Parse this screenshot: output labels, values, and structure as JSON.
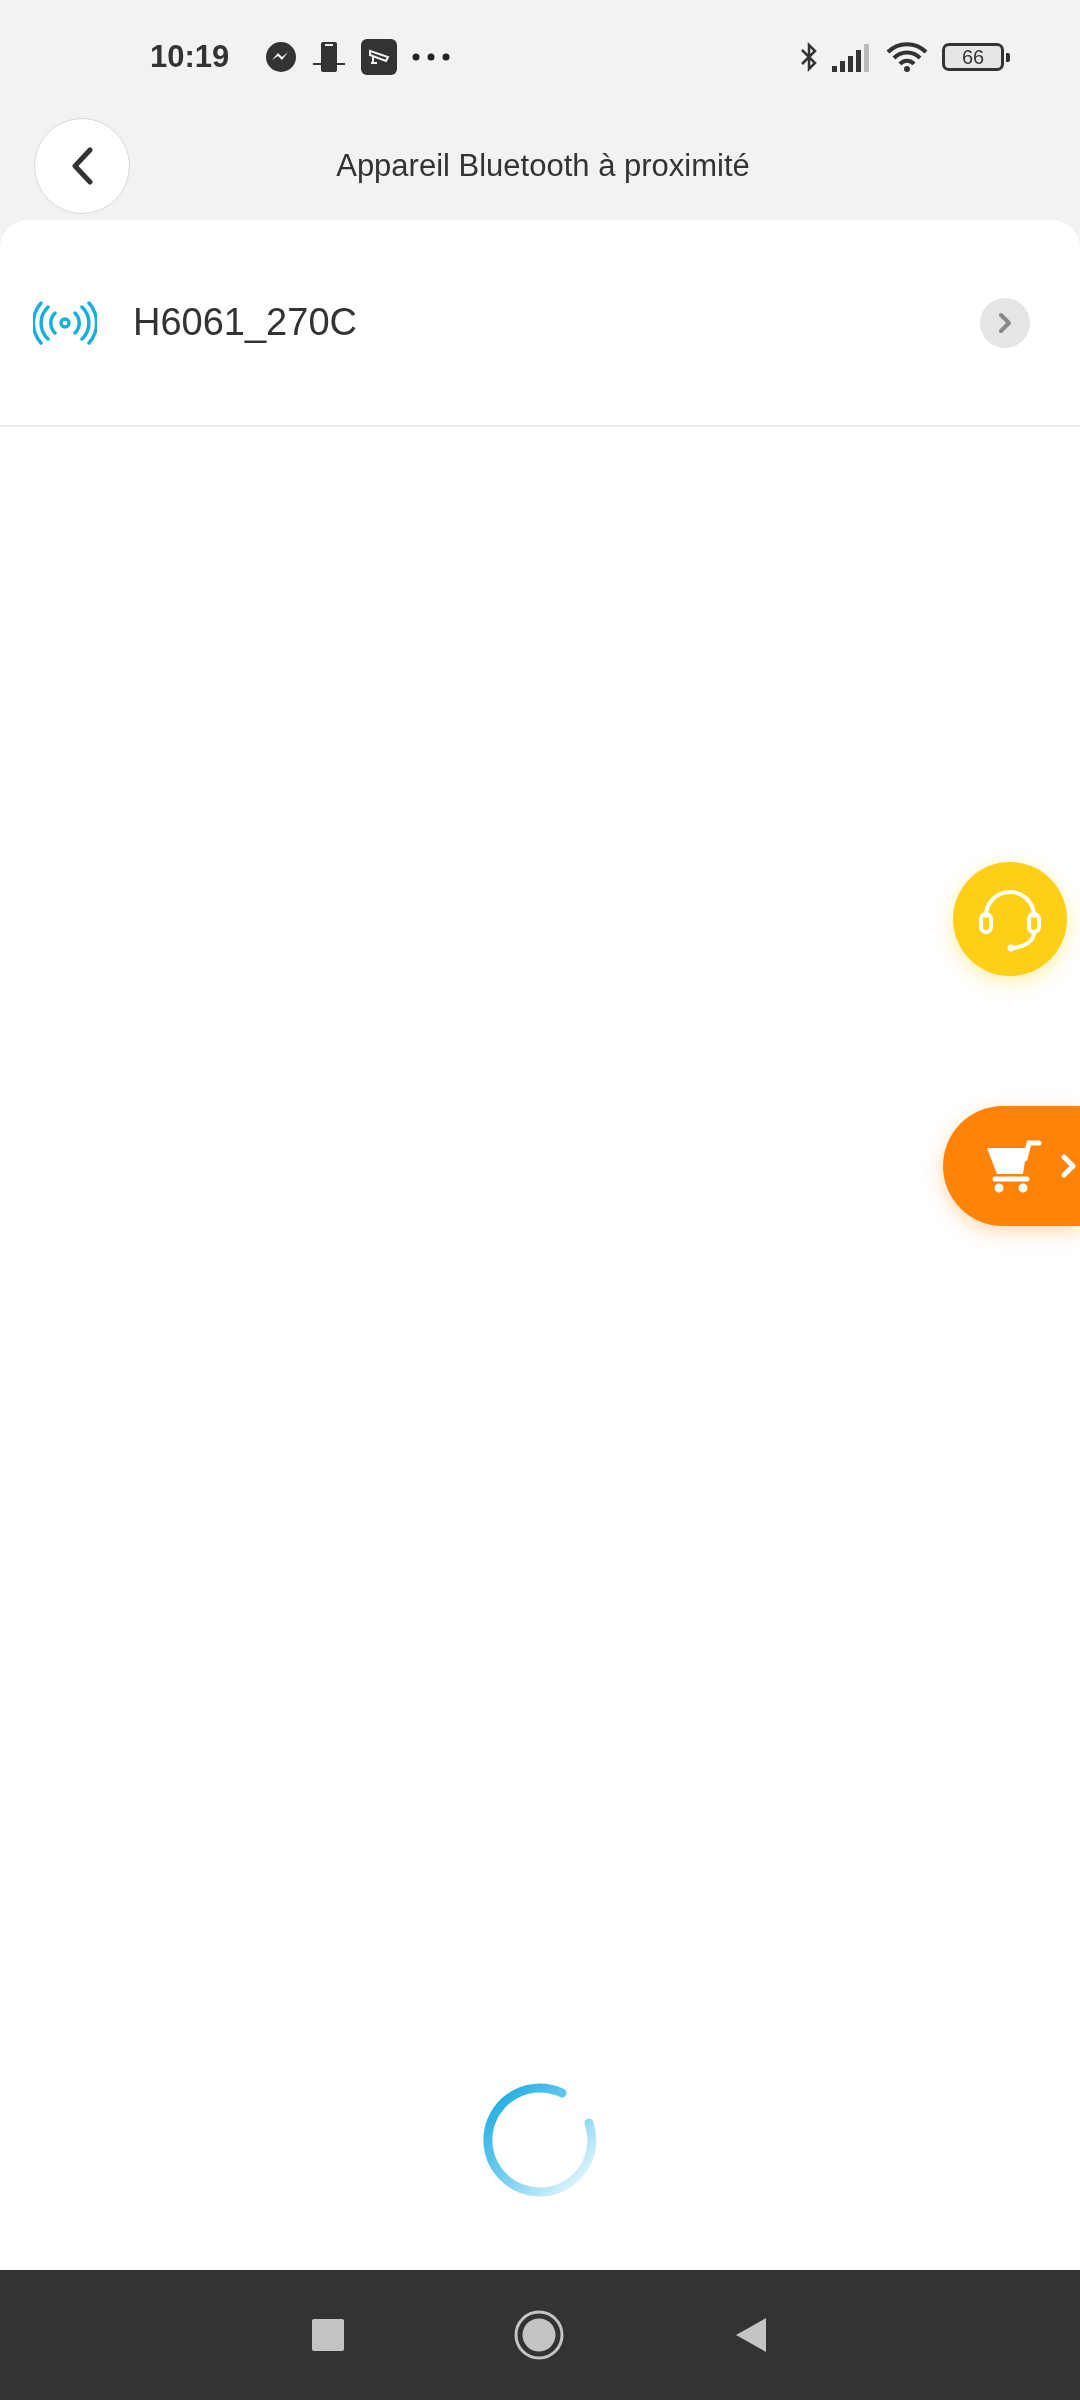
{
  "status_bar": {
    "time": "10:19",
    "battery": "66"
  },
  "header": {
    "title": "Appareil Bluetooth à proximité"
  },
  "devices": [
    {
      "name": "H6061_270C"
    }
  ]
}
